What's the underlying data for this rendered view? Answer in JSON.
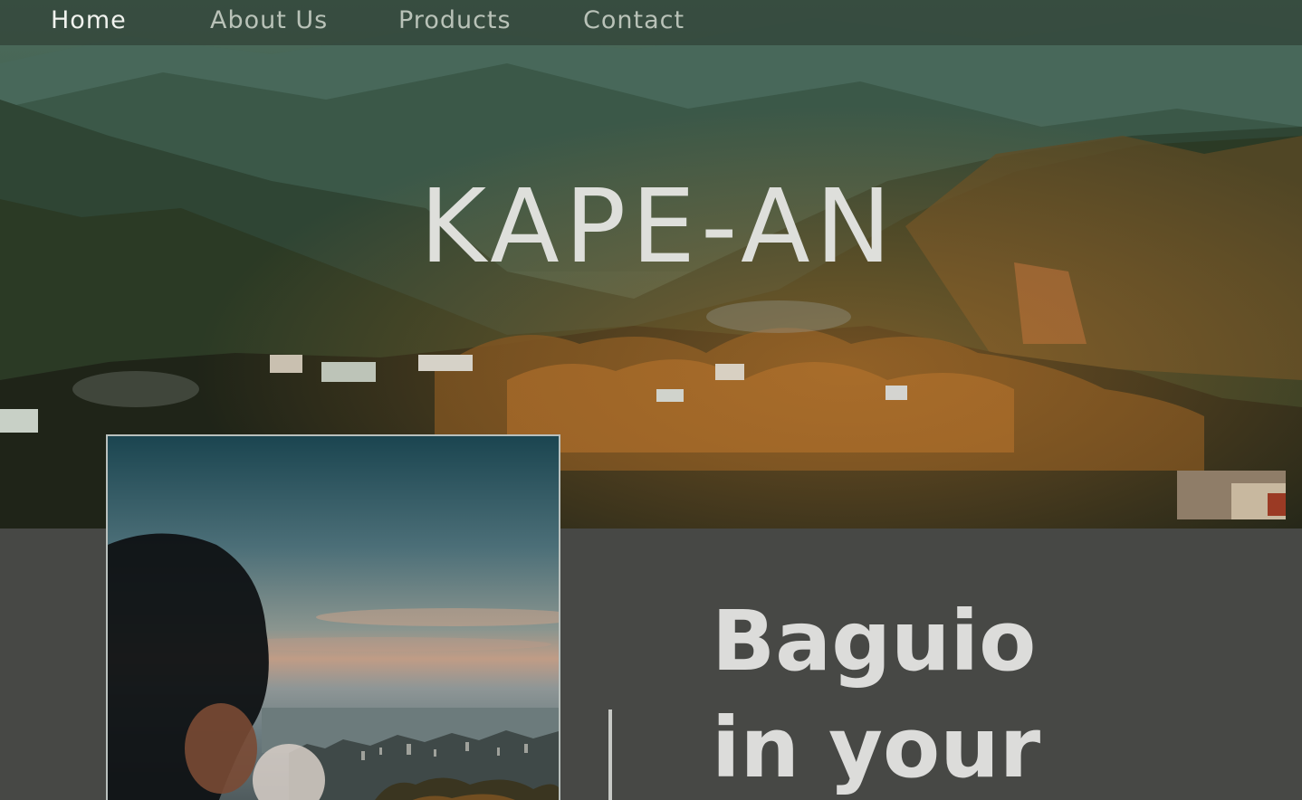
{
  "nav": {
    "items": [
      {
        "label": "Home",
        "active": true
      },
      {
        "label": "About Us",
        "active": false
      },
      {
        "label": "Products",
        "active": false
      },
      {
        "label": "Contact",
        "active": false
      }
    ]
  },
  "hero": {
    "title": "KAPE-AN"
  },
  "feature": {
    "headline_line1": "Baguio",
    "headline_line2": "in your"
  },
  "colors": {
    "nav_active": "#f1f3ef",
    "nav_inactive": "#b9c2b8",
    "lower_background": "#474845",
    "headline": "#dcdcda"
  }
}
